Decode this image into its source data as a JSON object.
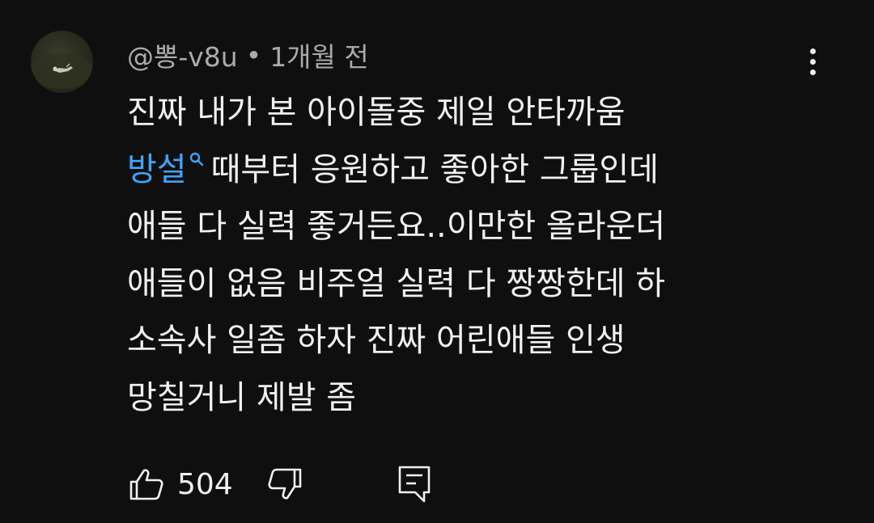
{
  "comment": {
    "author": "@뽕-v8u",
    "separator": "•",
    "timestamp": "1개월 전",
    "lines": {
      "l1": "진짜 내가 본 아이돌중 제일 안타까움",
      "l2_hashtag": "방설",
      "l2_rest": "때부터 응원하고 좋아한 그룹인데",
      "l3": "애들 다 실력 좋거든요..이만한 올라운더",
      "l4": "애들이 없음 비주얼 실력 다 짱짱한데 하",
      "l5": "소속사 일좀 하자 진짜 어린애들 인생",
      "l6": "망칠거니 제발 좀"
    },
    "like_count": "504",
    "icons": {
      "more": "more-vertical-icon",
      "like": "thumbs-up-icon",
      "dislike": "thumbs-down-icon",
      "reply": "reply-comment-icon",
      "hashtag_search": "search-icon"
    },
    "colors": {
      "background": "#0f0f0f",
      "text": "#f1f1f1",
      "secondary_text": "#aaaaaa",
      "link": "#3ea6ff"
    }
  }
}
